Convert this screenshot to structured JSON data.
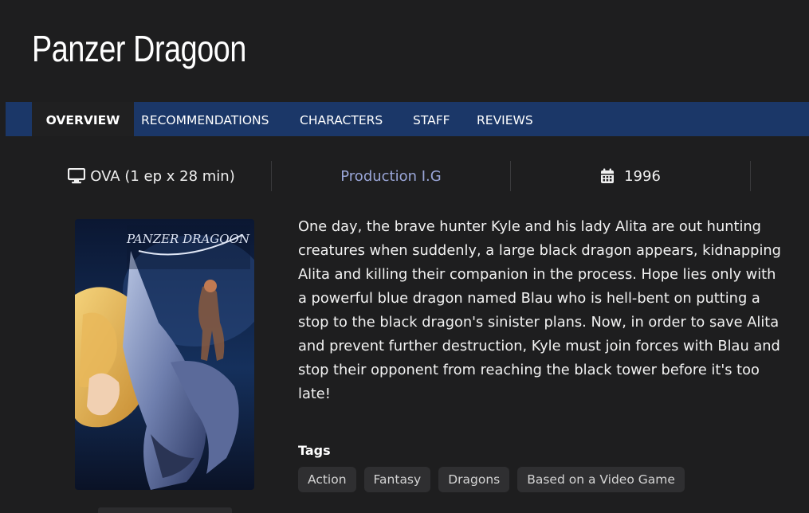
{
  "title": "Panzer Dragoon",
  "tabs": [
    {
      "label": "OVERVIEW",
      "active": true
    },
    {
      "label": "RECOMMENDATIONS",
      "active": false
    },
    {
      "label": "CHARACTERS",
      "active": false
    },
    {
      "label": "STAFF",
      "active": false
    },
    {
      "label": "REVIEWS",
      "active": false
    }
  ],
  "meta": {
    "format": "OVA (1 ep x 28 min)",
    "format_icon": "monitor-icon",
    "studio": "Production I.G",
    "year": "1996",
    "year_icon": "calendar-icon"
  },
  "cover": {
    "logo_text": "PANZER DRAGOON"
  },
  "synopsis": "One day, the brave hunter Kyle and his lady Alita are out hunting creatures when suddenly, a large black dragon appears, kidnapping Alita and killing their companion in the process. Hope lies only with a powerful blue dragon named Blau who is hell-bent on putting a stop to the black dragon's sinister plans. Now, in order to save Alita and prevent further destruction, Kyle must join forces with Blau and stop their opponent from reaching the black tower before it's too late!",
  "tags_heading": "Tags",
  "tags": [
    "Action",
    "Fantasy",
    "Dragons",
    "Based on a Video Game"
  ],
  "colors": {
    "background": "#1e1e1f",
    "tab_bar": "#1b3768",
    "studio_link": "#9aa6d8",
    "tag_bg": "#2f2f31"
  }
}
